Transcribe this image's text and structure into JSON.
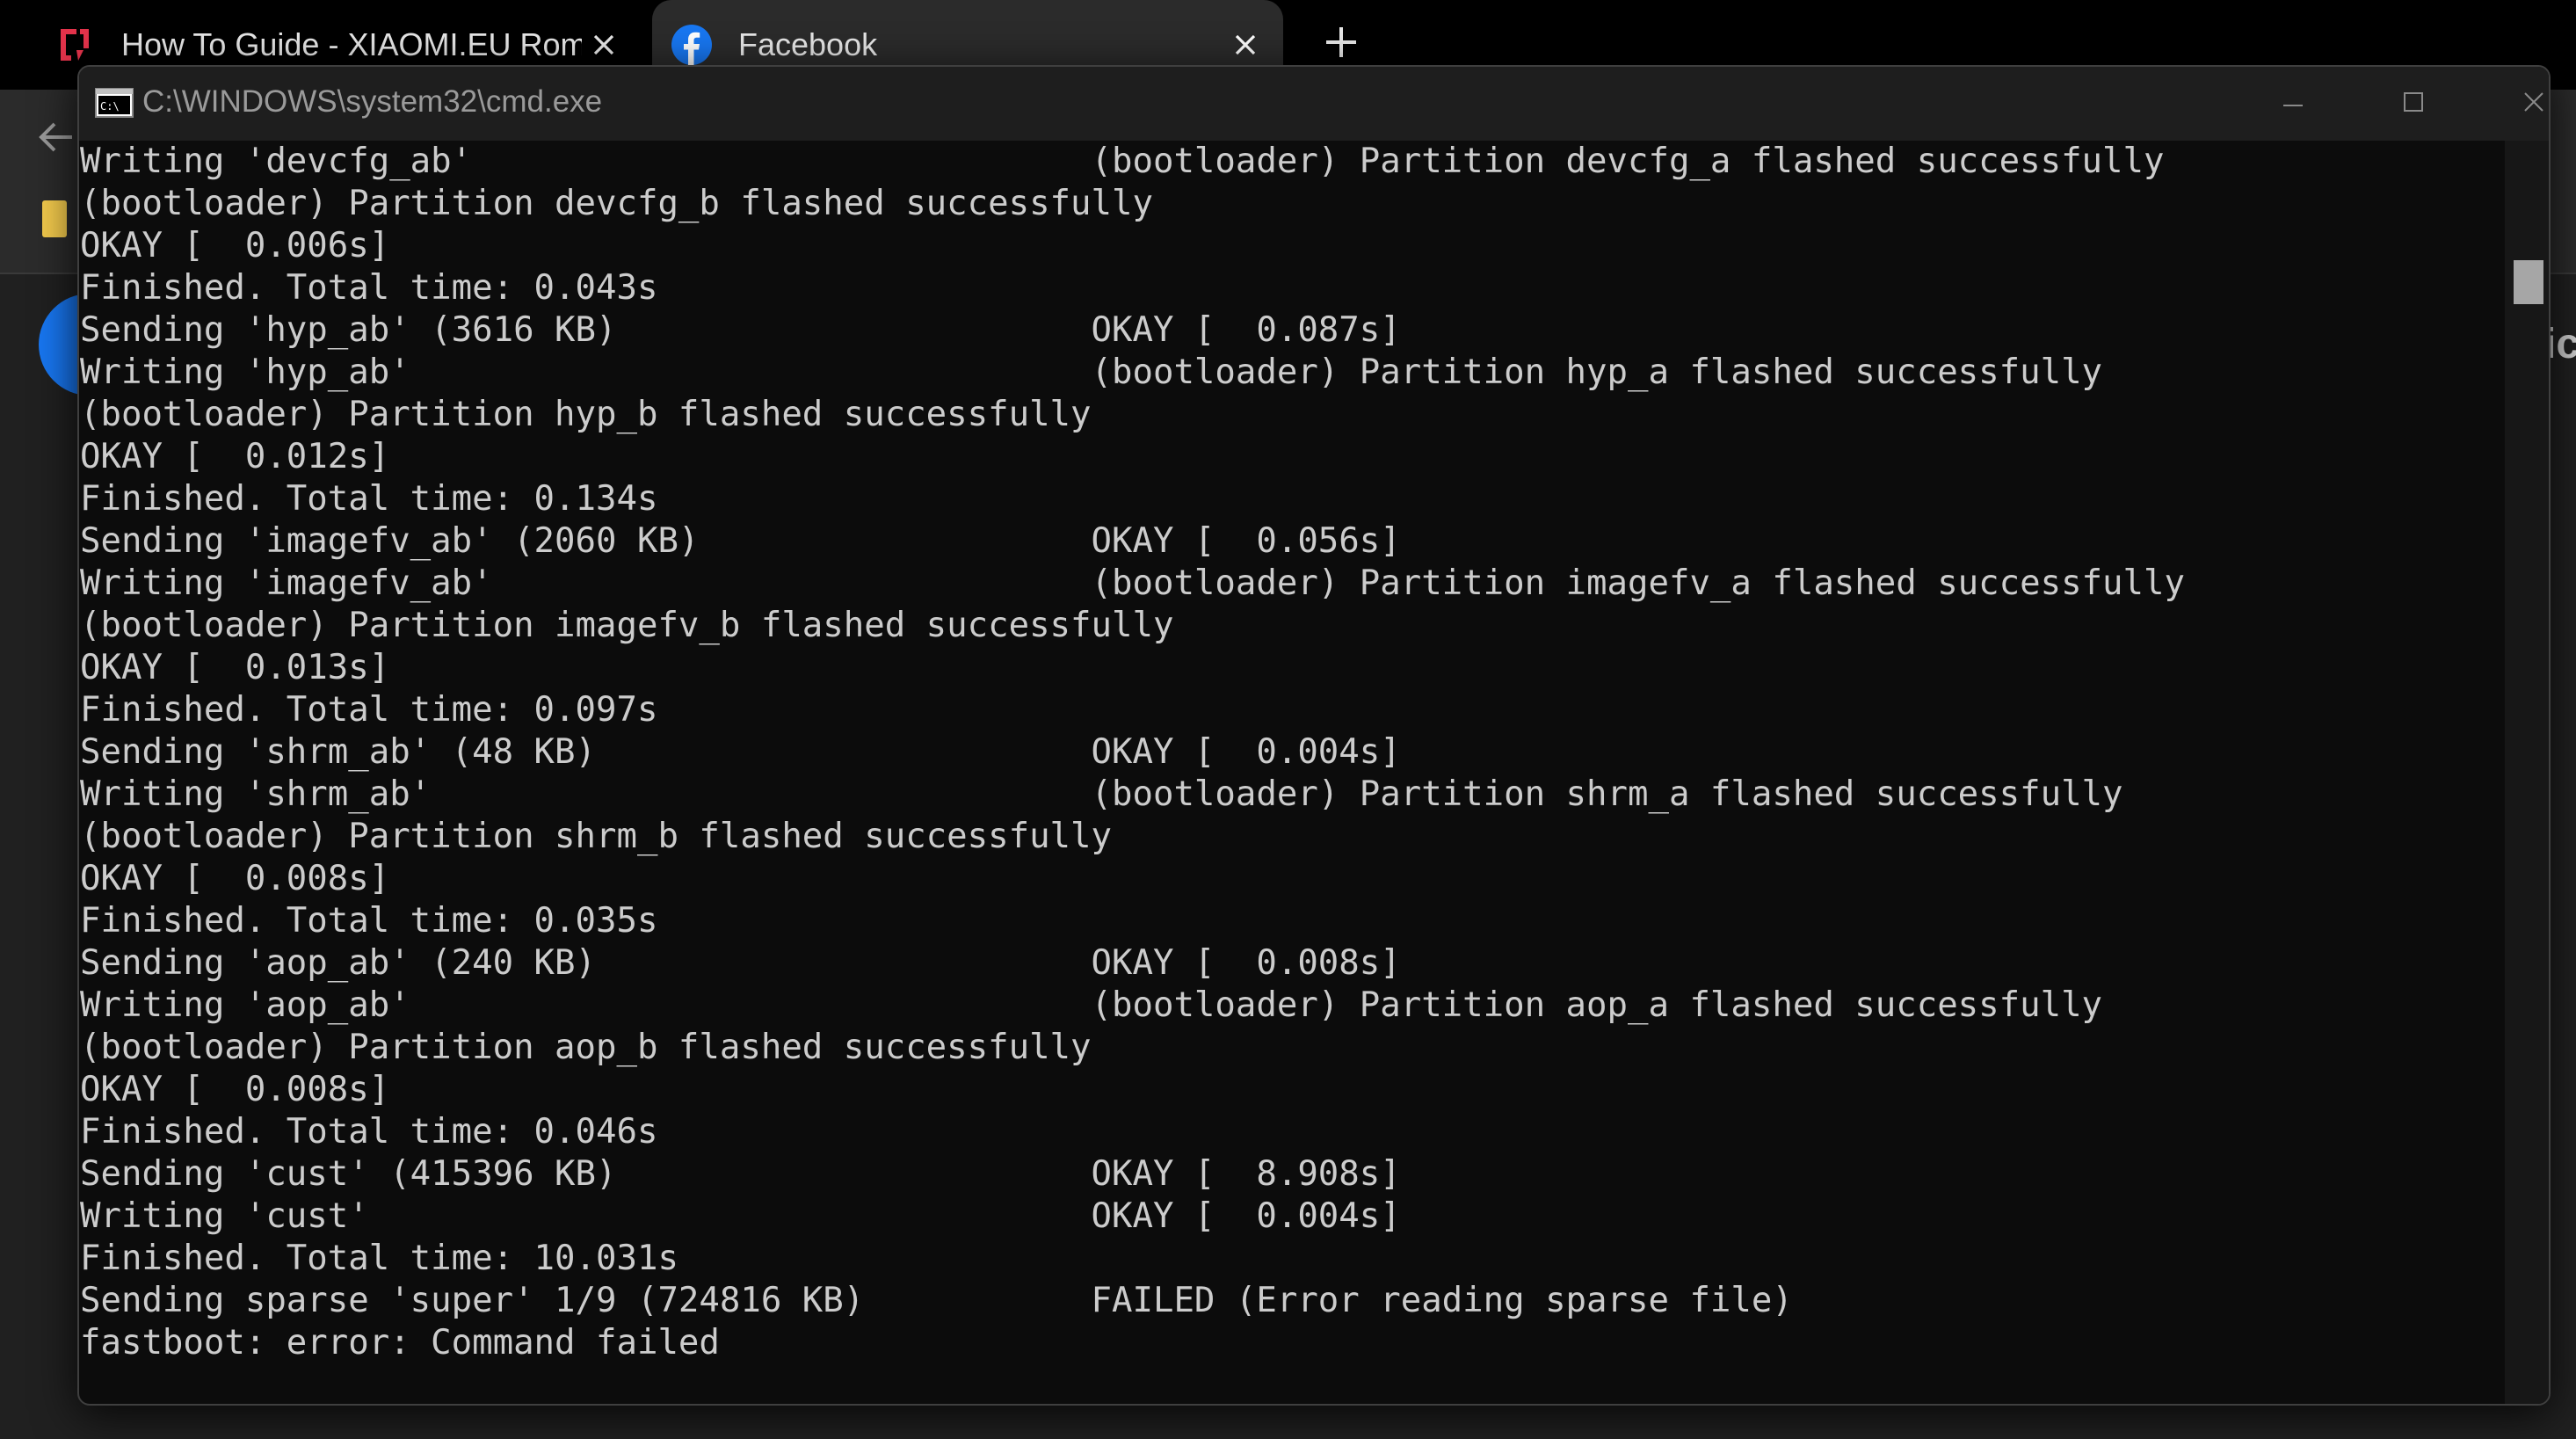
{
  "browser": {
    "tabs": [
      {
        "title": "How To Guide - XIAOMI.EU Rom",
        "favicon": "xiaomi-eu-icon",
        "active": false
      },
      {
        "title": "Facebook",
        "favicon": "facebook-icon",
        "active": true
      }
    ],
    "page_peek_text": "ic"
  },
  "console": {
    "title": "C:\\WINDOWS\\system32\\cmd.exe",
    "lines": [
      "Writing 'devcfg_ab'                              (bootloader) Partition devcfg_a flashed successfully",
      "(bootloader) Partition devcfg_b flashed successfully",
      "OKAY [  0.006s]",
      "Finished. Total time: 0.043s",
      "Sending 'hyp_ab' (3616 KB)                       OKAY [  0.087s]",
      "Writing 'hyp_ab'                                 (bootloader) Partition hyp_a flashed successfully",
      "(bootloader) Partition hyp_b flashed successfully",
      "OKAY [  0.012s]",
      "Finished. Total time: 0.134s",
      "Sending 'imagefv_ab' (2060 KB)                   OKAY [  0.056s]",
      "Writing 'imagefv_ab'                             (bootloader) Partition imagefv_a flashed successfully",
      "(bootloader) Partition imagefv_b flashed successfully",
      "OKAY [  0.013s]",
      "Finished. Total time: 0.097s",
      "Sending 'shrm_ab' (48 KB)                        OKAY [  0.004s]",
      "Writing 'shrm_ab'                                (bootloader) Partition shrm_a flashed successfully",
      "(bootloader) Partition shrm_b flashed successfully",
      "OKAY [  0.008s]",
      "Finished. Total time: 0.035s",
      "Sending 'aop_ab' (240 KB)                        OKAY [  0.008s]",
      "Writing 'aop_ab'                                 (bootloader) Partition aop_a flashed successfully",
      "(bootloader) Partition aop_b flashed successfully",
      "OKAY [  0.008s]",
      "Finished. Total time: 0.046s",
      "Sending 'cust' (415396 KB)                       OKAY [  8.908s]",
      "Writing 'cust'                                   OKAY [  0.004s]",
      "Finished. Total time: 10.031s",
      "Sending sparse 'super' 1/9 (724816 KB)           FAILED (Error reading sparse file)",
      "fastboot: error: Command failed"
    ]
  },
  "colors": {
    "console_bg": "#0c0c0c",
    "console_text": "#cccccc",
    "facebook_blue": "#1877f2",
    "xiaomi_red": "#e4334b"
  }
}
